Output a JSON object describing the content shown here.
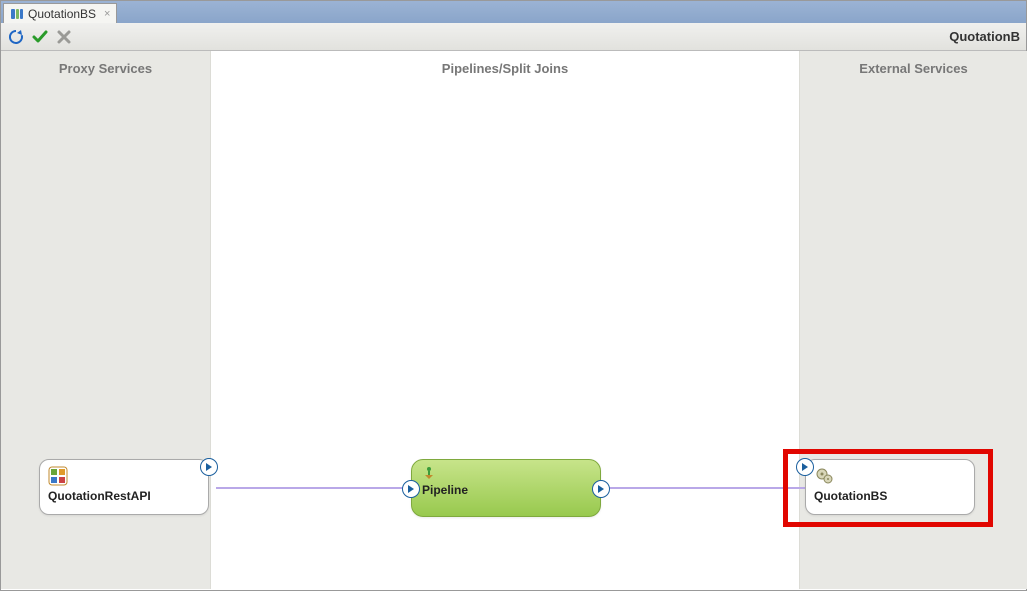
{
  "tab": {
    "label": "QuotationBS"
  },
  "toolbar": {
    "title_right": "QuotationB"
  },
  "lanes": {
    "left": "Proxy Services",
    "mid": "Pipelines/Split Joins",
    "right": "External Services"
  },
  "nodes": {
    "proxy": {
      "label": "QuotationRestAPI"
    },
    "pipeline": {
      "label": "Pipeline"
    },
    "business": {
      "label": "QuotationBS"
    }
  }
}
